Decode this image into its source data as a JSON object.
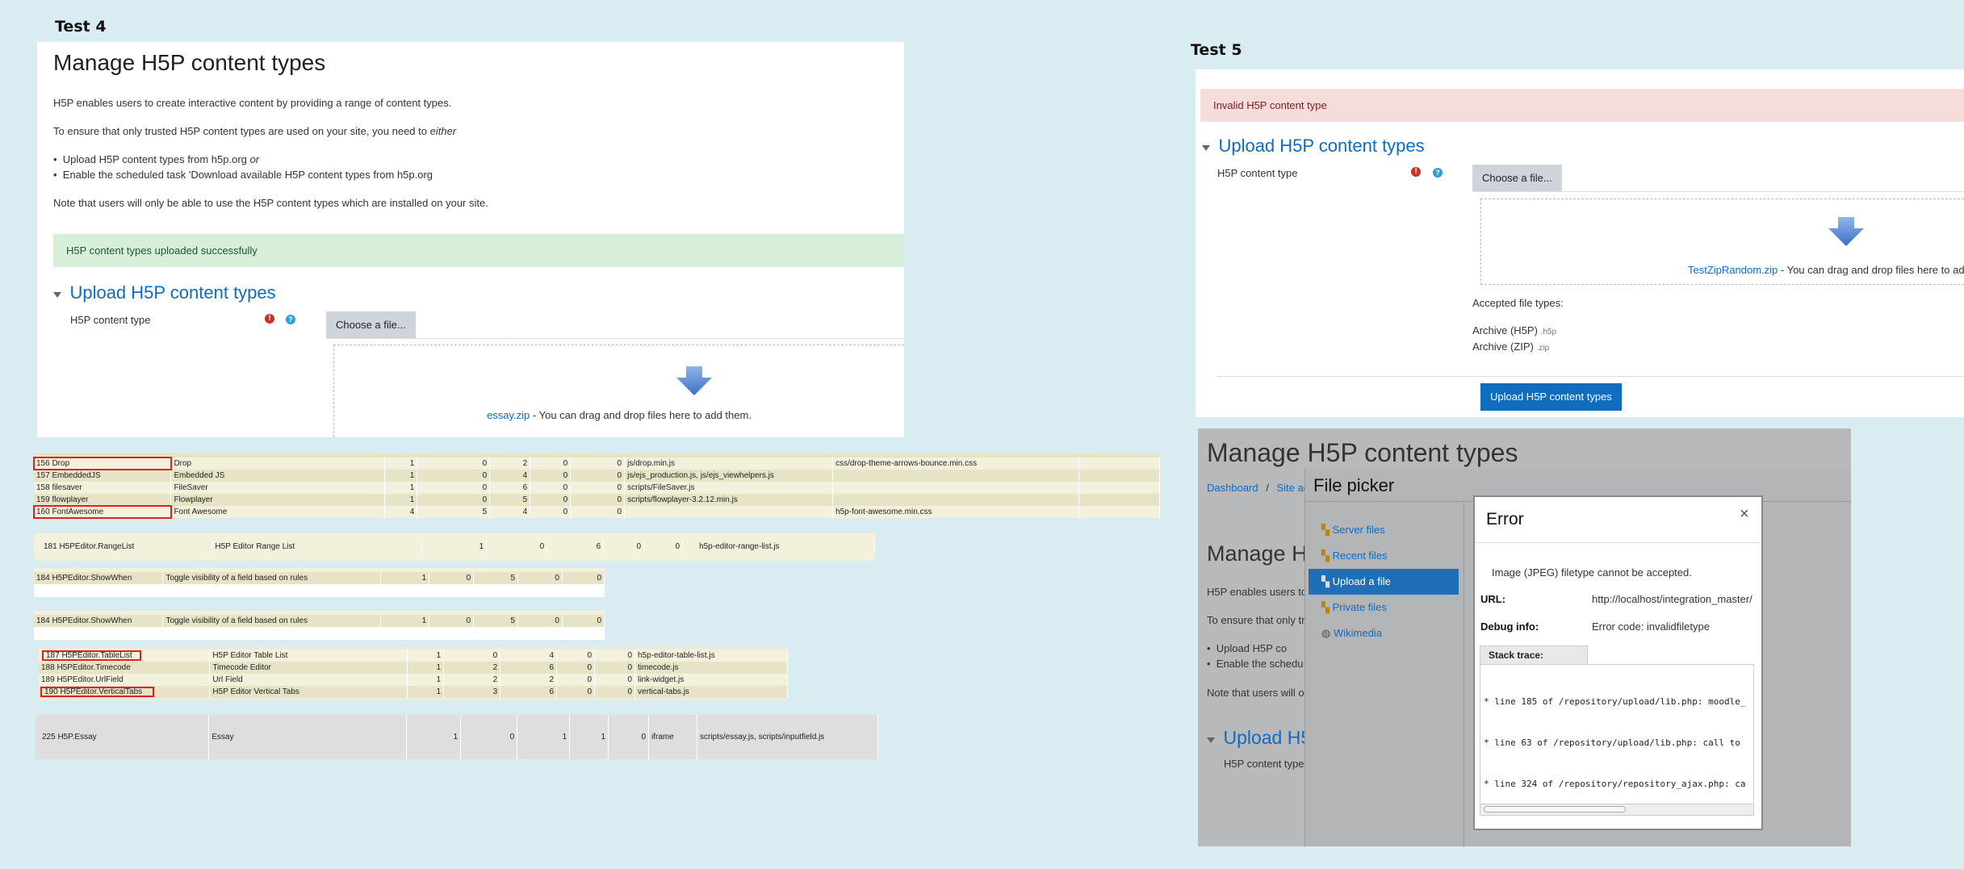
{
  "test4": {
    "label": "Test 4",
    "page_title": "Manage H5P content types",
    "intro": "H5P enables users to create interactive content by providing a range of content types.",
    "ensure": "To ensure that only trusted H5P content types are used on your site, you need to ",
    "ensure_em": "either",
    "bullets": [
      {
        "text": "Upload H5P content types from h5p.org ",
        "em": "or"
      },
      {
        "text": "Enable the scheduled task 'Download available H5P content types from h5p.org",
        "em": ""
      }
    ],
    "note": "Note that users will only be able to use the H5P content types which are installed on your site.",
    "success": "H5P content types uploaded successfully",
    "section": "Upload H5P content types",
    "field_label": "H5P content type",
    "choose_btn": "Choose a file...",
    "file_link": "essay.zip",
    "drop_hint": " - You can drag and drop files here to add them."
  },
  "tables": {
    "table1": [
      [
        "156 Drop",
        "Drop",
        "1",
        "0",
        "2",
        "0",
        "0",
        "js/drop.min.js",
        "css/drop-theme-arrows-bounce.min.css"
      ],
      [
        "157 EmbeddedJS",
        "Embedded JS",
        "1",
        "0",
        "4",
        "0",
        "0",
        "js/ejs_production.js, js/ejs_viewhelpers.js",
        ""
      ],
      [
        "158 filesaver",
        "FileSaver",
        "1",
        "0",
        "6",
        "0",
        "0",
        "scripts/FileSaver.js",
        ""
      ],
      [
        "159 flowplayer",
        "Flowplayer",
        "1",
        "0",
        "5",
        "0",
        "0",
        "scripts/flowplayer-3.2.12.min.js",
        ""
      ],
      [
        "160 FontAwesome",
        "Font Awesome",
        "4",
        "5",
        "4",
        "0",
        "0",
        "",
        "h5p-font-awesome.min.css"
      ]
    ],
    "table2": [
      [
        "181 H5PEditor.RangeList",
        "H5P Editor Range List",
        "1",
        "0",
        "6",
        "0",
        "0",
        "h5p-editor-range-list.js"
      ]
    ],
    "table3": [
      [
        "184 H5PEditor.ShowWhen",
        "Toggle visibility of a field based on rules",
        "1",
        "0",
        "5",
        "0",
        "0"
      ]
    ],
    "table4": [
      [
        "184 H5PEditor.ShowWhen",
        "Toggle visibility of a field based on rules",
        "1",
        "0",
        "5",
        "0",
        "0"
      ]
    ],
    "table5": [
      [
        "187 H5PEditor.TableList",
        "H5P Editor Table List",
        "1",
        "0",
        "4",
        "0",
        "0",
        "h5p-editor-table-list.js"
      ],
      [
        "188 H5PEditor.Timecode",
        "Timecode Editor",
        "1",
        "2",
        "6",
        "0",
        "0",
        "timecode.js"
      ],
      [
        "189 H5PEditor.UrlField",
        "Url Field",
        "1",
        "2",
        "2",
        "0",
        "0",
        "link-widget.js"
      ],
      [
        "190 H5PEditor.VerticalTabs",
        "H5P Editor Vertical Tabs",
        "1",
        "3",
        "6",
        "0",
        "0",
        "vertical-tabs.js"
      ]
    ],
    "table6": [
      [
        "225 H5P.Essay",
        "Essay",
        "1",
        "0",
        "1",
        "1",
        "0",
        "iframe",
        "scripts/essay.js, scripts/inputfield.js"
      ]
    ]
  },
  "test5": {
    "label": "Test 5",
    "error_alert": "Invalid H5P content type",
    "section": "Upload H5P content types",
    "field_label": "H5P content type",
    "choose_btn": "Choose a file...",
    "file_link": "TestZipRandom.zip",
    "drop_hint": " - You can drag and drop files here to ad",
    "accepted_label": "Accepted file types:",
    "types": [
      {
        "name": "Archive (H5P)",
        "ext": ".h5p"
      },
      {
        "name": "Archive (ZIP)",
        "ext": ".zip"
      }
    ],
    "submit_btn": "Upload H5P content types"
  },
  "test5_bg": {
    "page_title": "Manage H5P content types",
    "breadcrumb_1": "Dashboard",
    "breadcrumb_sep": "/",
    "breadcrumb_2": "Site ac",
    "heading2": "Manage H",
    "p1": "H5P enables users to",
    "p2": "To ensure that only tr",
    "b1": "Upload H5P co",
    "b2": "Enable the schedu",
    "note": "Note that users will o",
    "section": "Upload H5",
    "field_label": "H5P content type"
  },
  "file_picker": {
    "title": "File picker",
    "items": [
      {
        "label": "Server files"
      },
      {
        "label": "Recent files"
      },
      {
        "label": "Upload a file"
      },
      {
        "label": "Private files"
      },
      {
        "label": "Wikimedia"
      }
    ]
  },
  "error_dialog": {
    "title": "Error",
    "close": "×",
    "message": "Image (JPEG) filetype cannot be accepted.",
    "url_label": "URL:",
    "url_value": "http://localhost/integration_master/",
    "debug_label": "Debug info:",
    "debug_value": "Error code: invalidfiletype",
    "trace_tab": "Stack trace:",
    "trace": [
      "* line 185 of /repository/upload/lib.php: moodle_",
      "* line 63 of /repository/upload/lib.php: call to",
      "* line 324 of /repository/repository_ajax.php: ca"
    ]
  },
  "colors": {
    "accent": "#0f6cbf",
    "success_bg": "#d7efd9",
    "error_bg": "#f7dcdc",
    "highlight": "#dd2222"
  }
}
